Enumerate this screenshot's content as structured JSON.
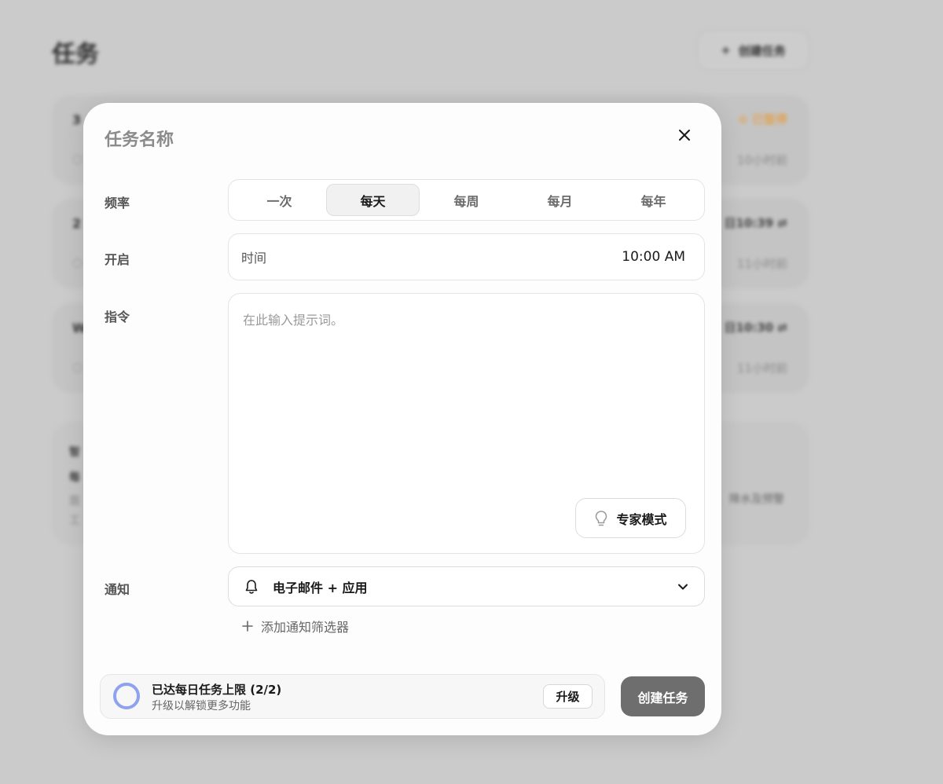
{
  "background": {
    "page_title": "任务",
    "create_button_label": "创建任务",
    "cards": [
      {
        "title": "3",
        "status": "已暂停",
        "time_ago": "10小时前"
      },
      {
        "title": "2",
        "schedule": "日10:39",
        "time_ago": "11小时前"
      },
      {
        "title": "W",
        "schedule": "日10:30",
        "time_ago": "11小时前"
      }
    ],
    "info_card": {
      "line1": "智",
      "line2": "每",
      "line3": "面",
      "line4": "工",
      "right_text": "降水及预警"
    }
  },
  "modal": {
    "title": "任务名称",
    "frequency": {
      "label": "频率",
      "options": [
        "一次",
        "每天",
        "每周",
        "每月",
        "每年"
      ],
      "selected": "每天"
    },
    "start": {
      "label": "开启",
      "field_label": "时间",
      "value": "10:00 AM"
    },
    "instruction": {
      "label": "指令",
      "placeholder": "在此输入提示词。",
      "expert_mode_label": "专家模式"
    },
    "notification": {
      "label": "通知",
      "value": "电子邮件 + 应用",
      "add_filter_label": "添加通知筛选器"
    },
    "limit_banner": {
      "title": "已达每日任务上限 (2/2)",
      "subtitle": "升级以解锁更多功能",
      "upgrade_label": "升级"
    },
    "create_button_label": "创建任务"
  },
  "colors": {
    "overlay": "#cbcbcb",
    "ring_accent": "#8ea2ef",
    "primary_button": "#6e6e6e",
    "paused_status": "#e0a458"
  }
}
